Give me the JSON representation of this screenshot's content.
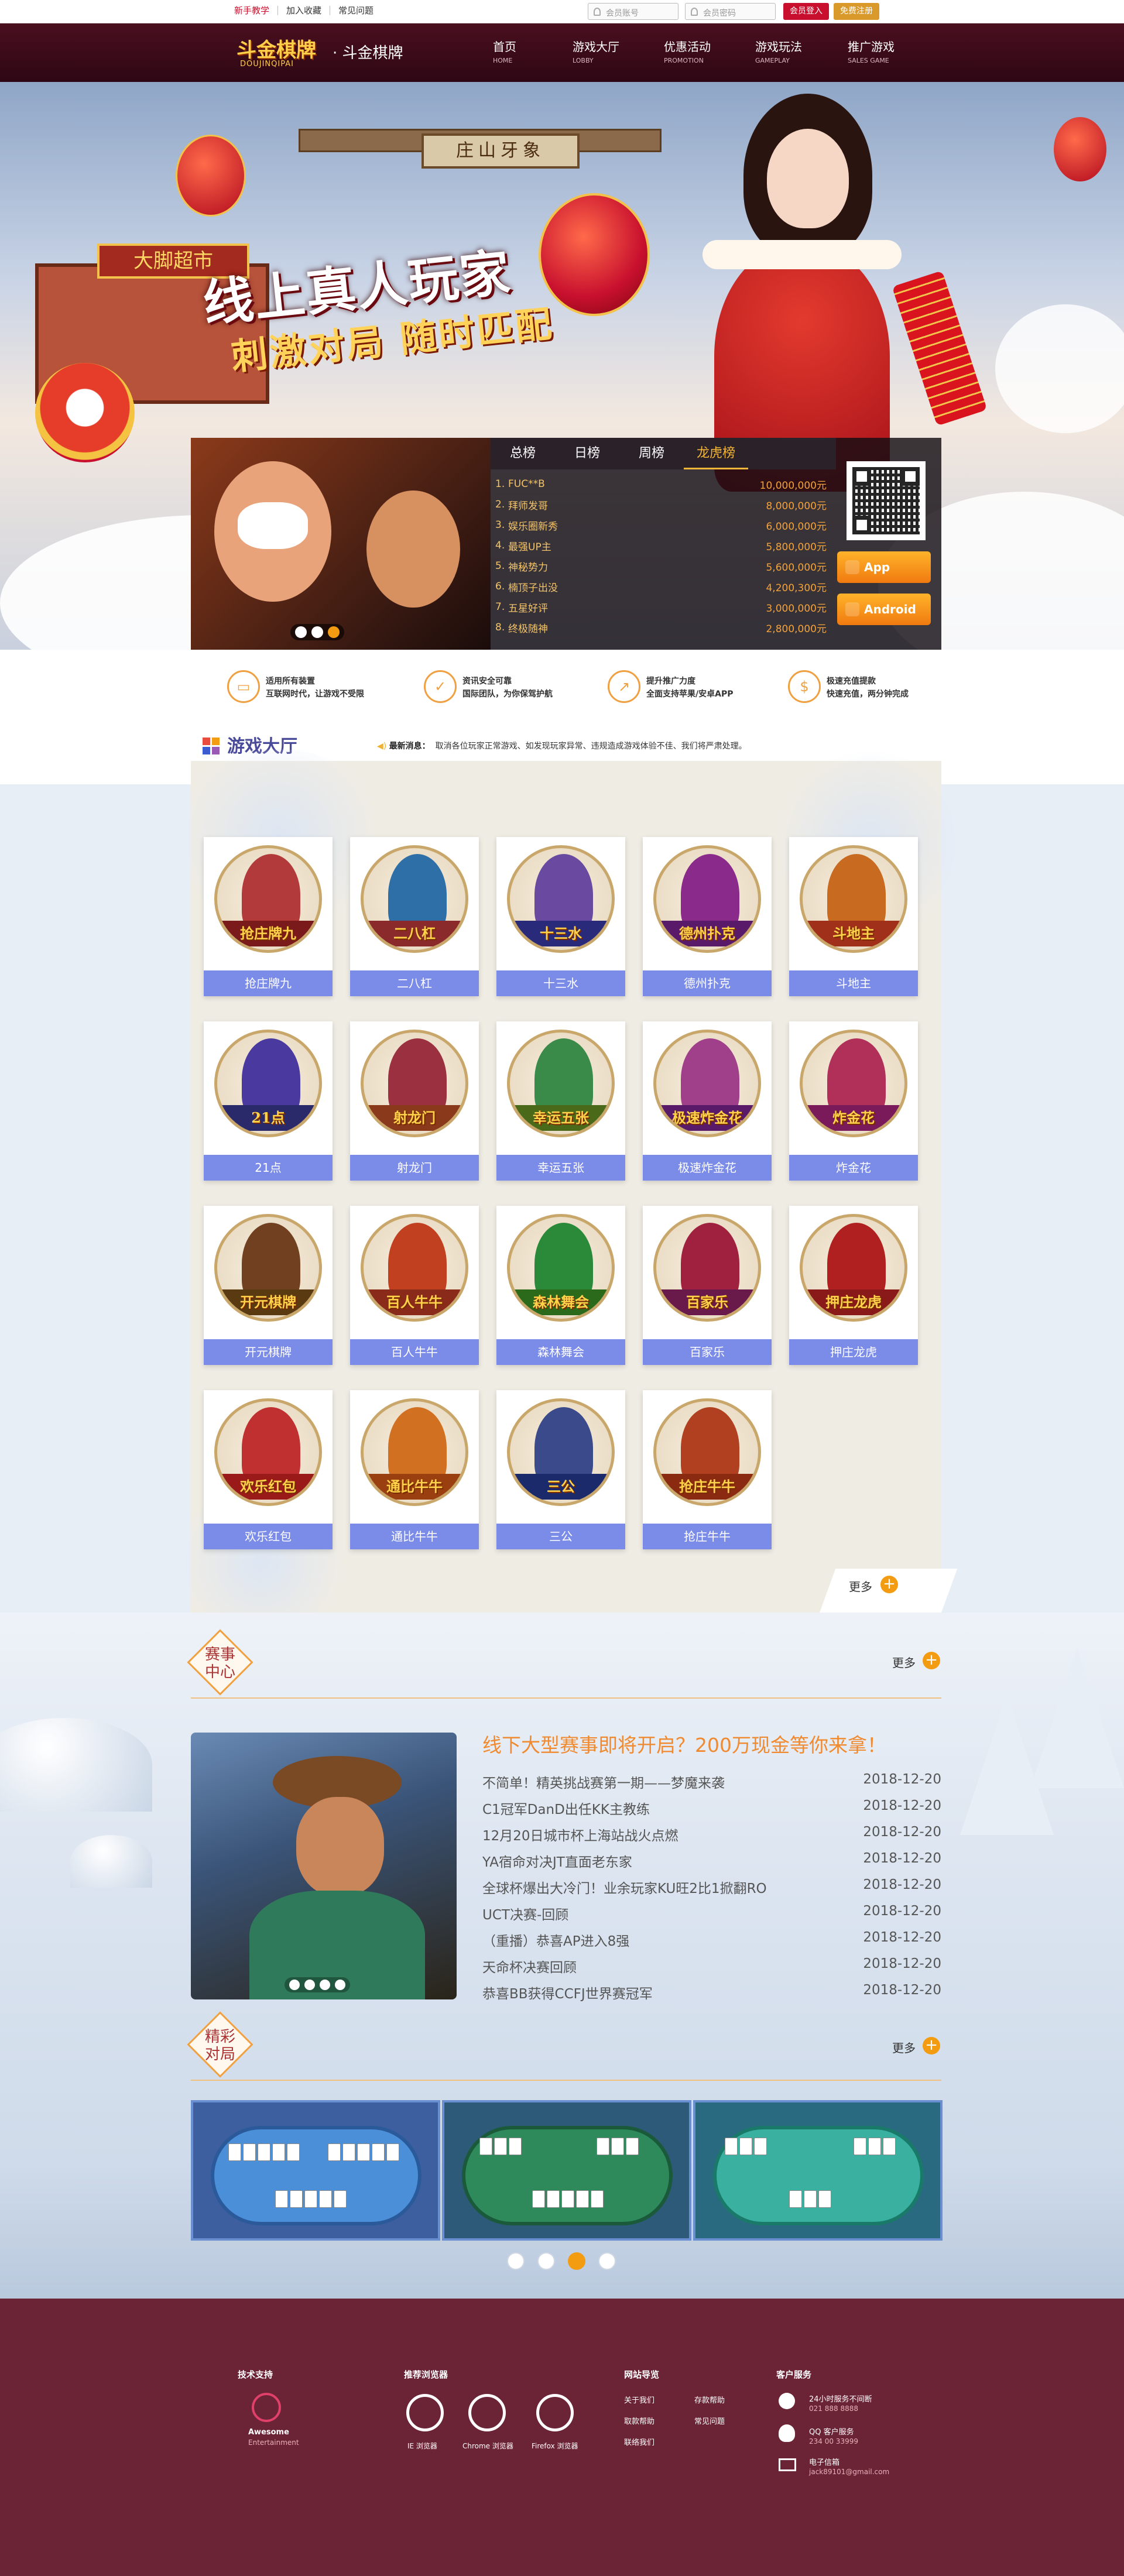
{
  "topbar": {
    "links": [
      "新手教学",
      "加入收藏",
      "常见问题"
    ],
    "account_placeholder": "会员账号",
    "password_placeholder": "会员密码",
    "login": "会员登入",
    "register": "免费注册"
  },
  "brand": {
    "logo": "斗金棋牌",
    "logo_sub": "DOUJINQIPAI",
    "site_name": "· 斗金棋牌"
  },
  "nav": [
    {
      "cn": "首页",
      "en": "HOME"
    },
    {
      "cn": "游戏大厅",
      "en": "LOBBY"
    },
    {
      "cn": "优惠活动",
      "en": "PROMOTION"
    },
    {
      "cn": "游戏玩法",
      "en": "GAMEPLAY"
    },
    {
      "cn": "推广游戏",
      "en": "SALES GAME"
    }
  ],
  "banner": {
    "slogan1": "线上真人玩家",
    "slogan2": "刺激对局 随时匹配",
    "gate_sign": "庄山牙象",
    "house_sign": "大脚超市"
  },
  "ranking": {
    "tabs": [
      "总榜",
      "日榜",
      "周榜",
      "龙虎榜"
    ],
    "active_tab": "龙虎榜",
    "rows": [
      {
        "rank": "1.",
        "name": "FUC**B",
        "value": "10,000,000元"
      },
      {
        "rank": "2.",
        "name": "拜师发哥",
        "value": "8,000,000元"
      },
      {
        "rank": "3.",
        "name": "娱乐圈新秀",
        "value": "6,000,000元"
      },
      {
        "rank": "4.",
        "name": "最强UP主",
        "value": "5,800,000元"
      },
      {
        "rank": "5.",
        "name": "神秘势力",
        "value": "5,600,000元"
      },
      {
        "rank": "6.",
        "name": "楠顶子出没",
        "value": "4,200,300元"
      },
      {
        "rank": "7.",
        "name": "五星好评",
        "value": "3,000,000元"
      },
      {
        "rank": "8.",
        "name": "终极随神",
        "value": "2,800,000元"
      }
    ]
  },
  "downloads": {
    "ios": "App Seore",
    "android": "Android"
  },
  "features": [
    {
      "l1": "适用所有装置",
      "l2": "互联网时代，让游戏不受限"
    },
    {
      "l1": "资讯安全可靠",
      "l2": "国际团队，为你保驾护航"
    },
    {
      "l1": "提升推广力度",
      "l2": "全面支持苹果/安卓APP"
    },
    {
      "l1": "极速充值提款",
      "l2": "快速充值，两分钟完成"
    }
  ],
  "lobby": {
    "title": "游戏大厅",
    "notice_label": "最新消息：",
    "notice_text": "取消各位玩家正常游戏、如发现玩家异常、违规造成游戏体验不佳、我们将严肃处理。",
    "more": "更多",
    "games": [
      {
        "name": "抢庄牌九",
        "plate": "抢庄牌九"
      },
      {
        "name": "二八杠",
        "plate": "二八杠"
      },
      {
        "name": "十三水",
        "plate": "十三水"
      },
      {
        "name": "德州扑克",
        "plate": "德州扑克"
      },
      {
        "name": "斗地主",
        "plate": "斗地主"
      },
      {
        "name": "21点",
        "plate": "21点"
      },
      {
        "name": "射龙门",
        "plate": "射龙门"
      },
      {
        "name": "幸运五张",
        "plate": "幸运五张"
      },
      {
        "name": "极速炸金花",
        "plate": "极速炸金花"
      },
      {
        "name": "炸金花",
        "plate": "炸金花"
      },
      {
        "name": "开元棋牌",
        "plate": "开元棋牌"
      },
      {
        "name": "百人牛牛",
        "plate": "百人牛牛"
      },
      {
        "name": "森林舞会",
        "plate": "森林舞会"
      },
      {
        "name": "百家乐",
        "plate": "百家乐"
      },
      {
        "name": "押庄龙虎",
        "plate": "押庄龙虎"
      },
      {
        "name": "欢乐红包",
        "plate": "欢乐红包"
      },
      {
        "name": "通比牛牛",
        "plate": "通比牛牛"
      },
      {
        "name": "三公",
        "plate": "三公"
      },
      {
        "name": "抢庄牛牛",
        "plate": "抢庄牛牛"
      }
    ]
  },
  "events": {
    "title_l1": "赛事",
    "title_l2": "中心",
    "more": "更多",
    "headline": "线下大型赛事即将开启？200万现金等你来拿！",
    "items": [
      {
        "t": "不简单！精英挑战赛第一期——梦魔来袭",
        "d": "2018-12-20"
      },
      {
        "t": "C1冠军DanD出任KK主教练",
        "d": "2018-12-20"
      },
      {
        "t": "12月20日城市杯上海站战火点燃",
        "d": "2018-12-20"
      },
      {
        "t": "YA宿命对决JT直面老东家",
        "d": "2018-12-20"
      },
      {
        "t": "全球杯爆出大冷门！业余玩家KU旺2比1掀翻RO",
        "d": "2018-12-20"
      },
      {
        "t": "UCT决赛-回顾",
        "d": "2018-12-20"
      },
      {
        "t": "（重播）恭喜AP进入8强",
        "d": "2018-12-20"
      },
      {
        "t": "天命杯决赛回顾",
        "d": "2018-12-20"
      },
      {
        "t": "恭喜BB获得CCFJ世界赛冠军",
        "d": "2018-12-20"
      }
    ]
  },
  "matches": {
    "title_l1": "精彩",
    "title_l2": "对局",
    "more": "更多"
  },
  "footer": {
    "tech_title": "技术支持",
    "tech_name": "Awesome",
    "tech_sub": "Entertainment",
    "browser_title": "推荐浏览器",
    "browsers": [
      "IE 浏览器",
      "Chrome 浏览器",
      "Firefox 浏览器"
    ],
    "nav_title": "网站导览",
    "nav_links": [
      "关于我们",
      "存款帮助",
      "取款帮助",
      "常见问题",
      "联络我们"
    ],
    "service_title": "客户服务",
    "service": [
      {
        "label": "24小时服务不间断",
        "value": "021 888 8888"
      },
      {
        "label": "QQ 客户服务",
        "value": "234 00 33999"
      },
      {
        "label": "电子信箱",
        "value": "jack89101@gmail.com"
      }
    ]
  },
  "colors": {
    "accent": "#f39c12",
    "nav_bg": "#3a0a18",
    "footer_bg": "#6b2336",
    "label_blue": "#7b8be8"
  }
}
